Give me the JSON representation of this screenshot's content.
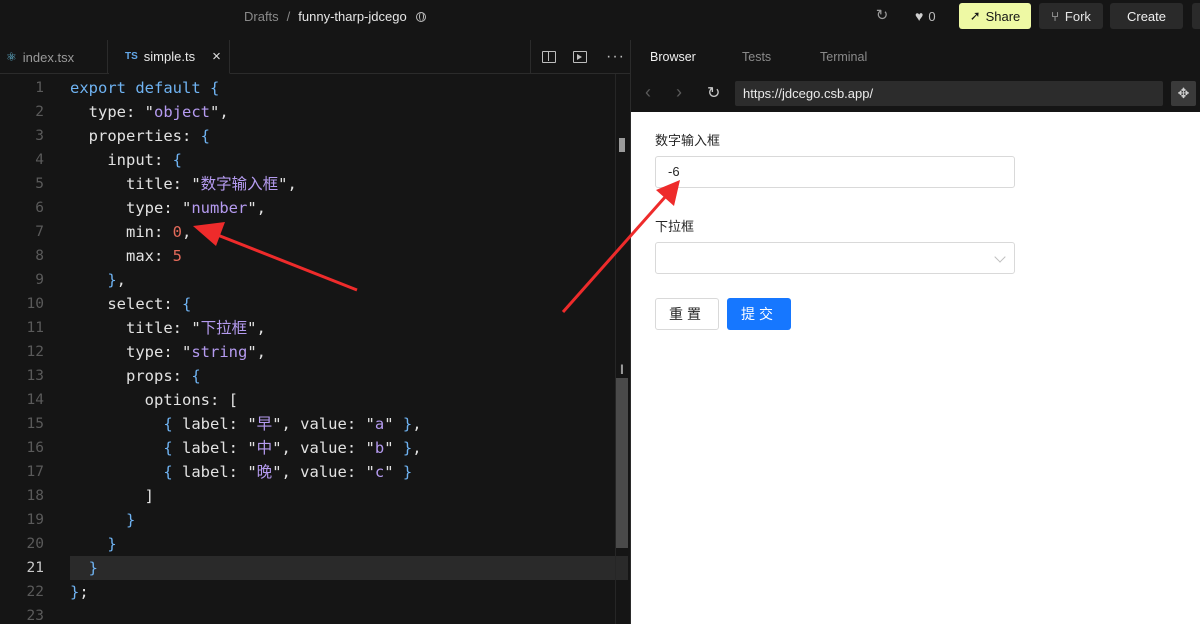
{
  "topbar": {
    "breadcrumb_root": "Drafts",
    "breadcrumb_sep": "/",
    "sandbox_name": "funny-tharp-jdcego",
    "likes": "0",
    "share_label": "Share",
    "fork_label": "Fork",
    "create_label": "Create",
    "share_color": "#eef9a4"
  },
  "editor": {
    "tabs": [
      {
        "label": "index.tsx",
        "icon": "react-icon"
      },
      {
        "label": "simple.ts",
        "icon": "ts-icon",
        "badge": "TS"
      }
    ],
    "active_line": 21,
    "line_numbers": [
      "1",
      "2",
      "3",
      "4",
      "5",
      "6",
      "7",
      "8",
      "9",
      "10",
      "11",
      "12",
      "13",
      "14",
      "15",
      "16",
      "17",
      "18",
      "19",
      "20",
      "21",
      "22",
      "23"
    ],
    "lines": [
      "export default {",
      "  type: \"object\",",
      "  properties: {",
      "    input: {",
      "      title: \"数字输入框\",",
      "      type: \"number\",",
      "      min: 0,",
      "      max: 5",
      "    },",
      "    select: {",
      "      title: \"下拉框\",",
      "      type: \"string\",",
      "      props: {",
      "        options: [",
      "          { label: \"早\", value: \"a\" },",
      "          { label: \"中\", value: \"b\" },",
      "          { label: \"晚\", value: \"c\" }",
      "        ]",
      "      }",
      "    }",
      "  }",
      "};",
      ""
    ]
  },
  "preview": {
    "tabs": [
      "Browser",
      "Tests",
      "Terminal"
    ],
    "url": "https://jdcego.csb.app/",
    "form": {
      "number_label": "数字输入框",
      "number_value": "-6",
      "select_label": "下拉框",
      "select_value": "",
      "reset_label": "重置",
      "submit_label": "提交",
      "submit_color": "#1677ff"
    }
  },
  "annotations": {
    "arrow_color": "#ee2b2b"
  }
}
